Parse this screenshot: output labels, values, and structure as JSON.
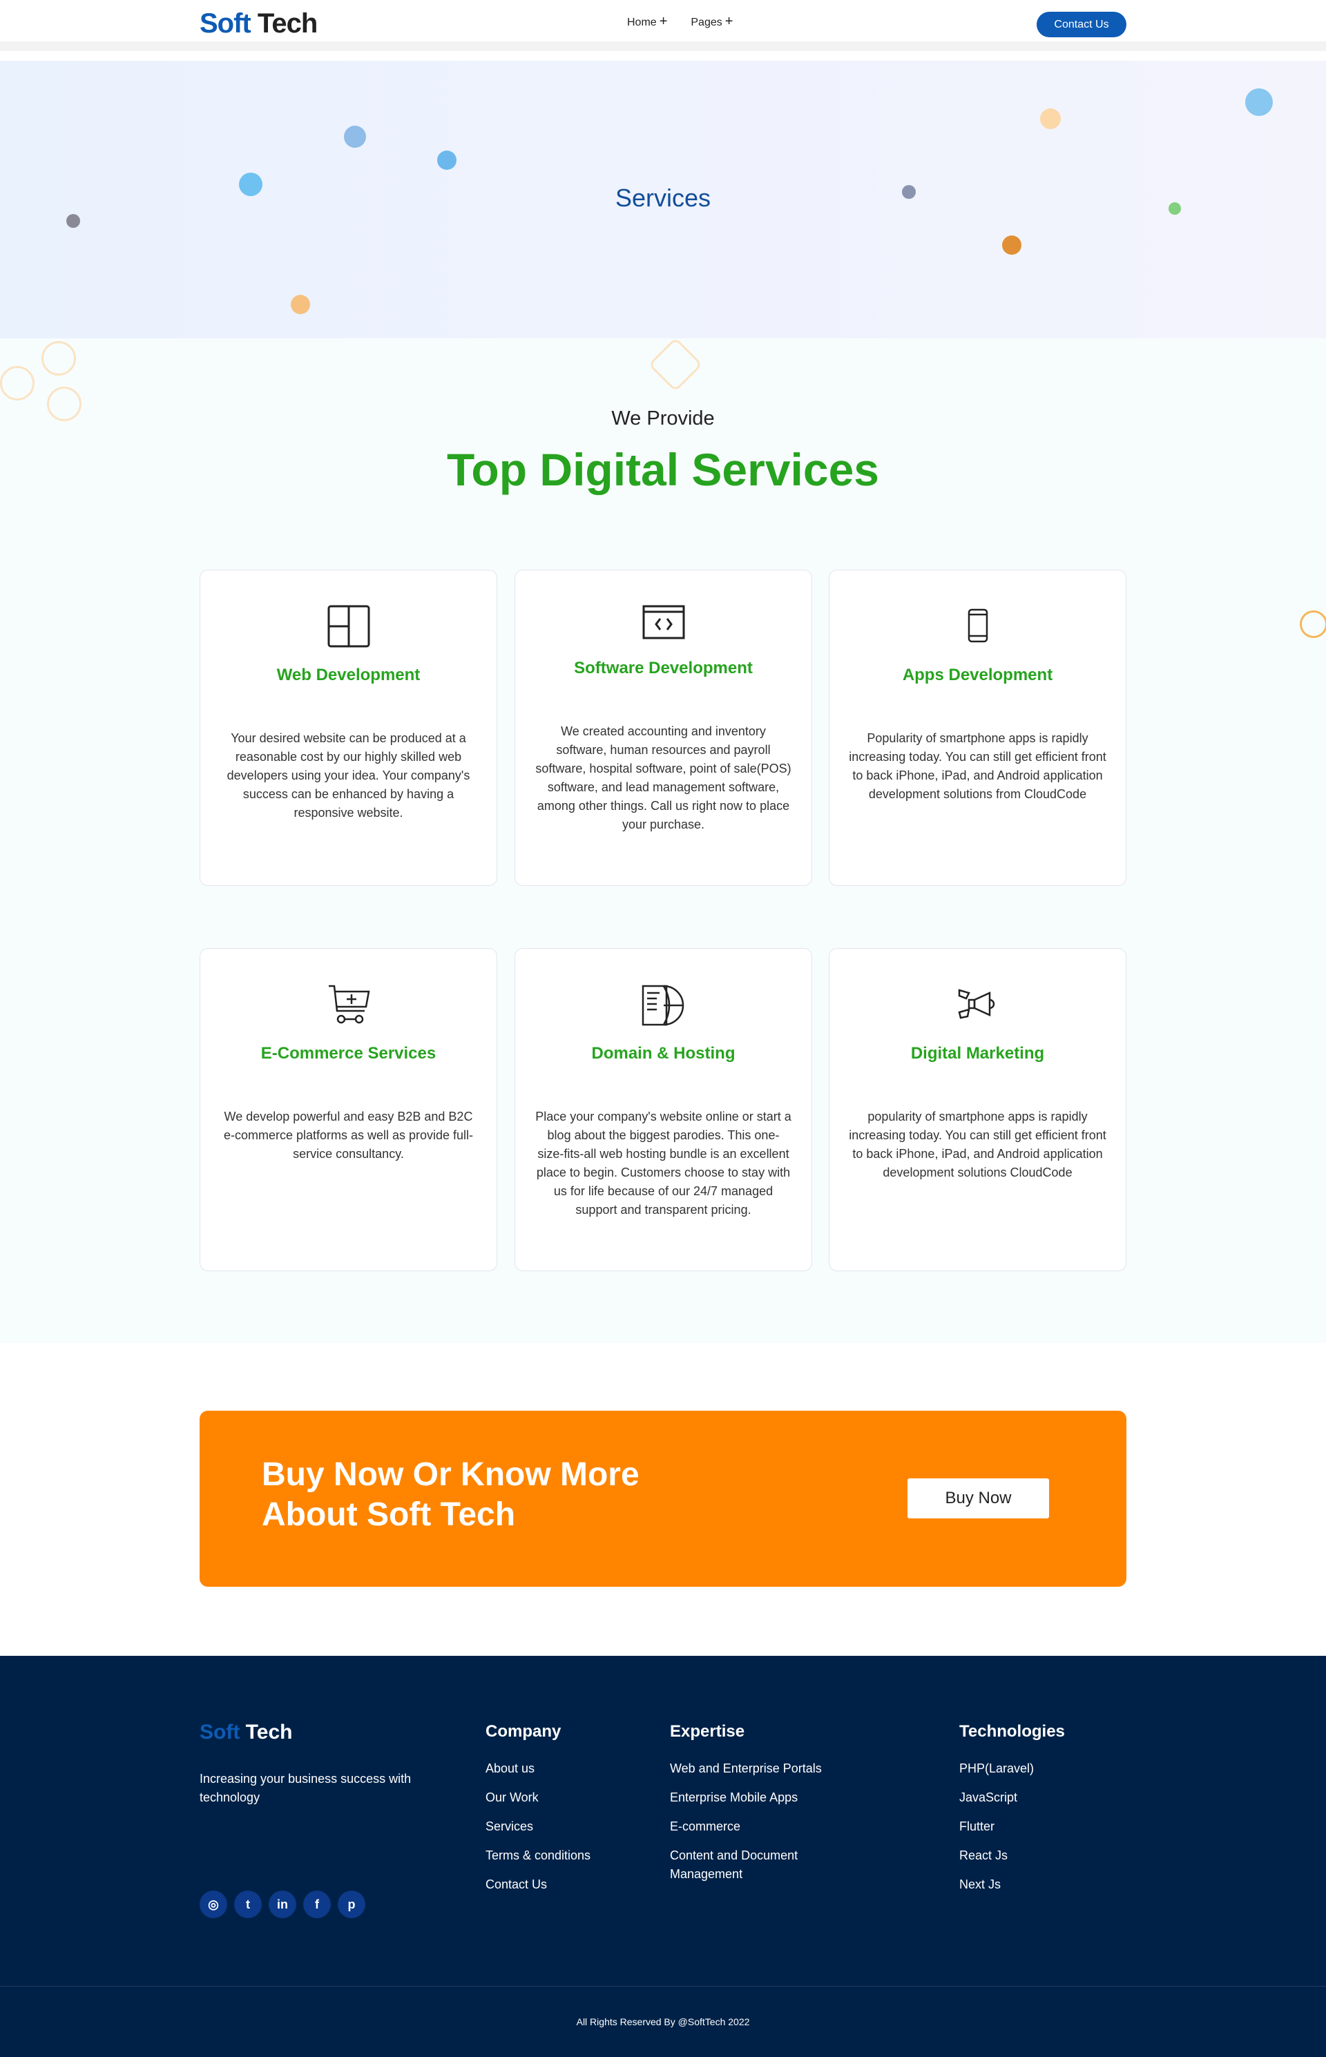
{
  "header": {
    "logo_a": "Soft",
    "logo_b": "Tech",
    "nav": [
      {
        "label": "Home"
      },
      {
        "label": "Pages"
      }
    ],
    "contact": "Contact Us"
  },
  "hero": {
    "title": "Services"
  },
  "services": {
    "eyebrow": "We Provide",
    "title": "Top Digital Services",
    "cards": [
      {
        "icon": "layout-icon",
        "title": "Web Development",
        "text": "Your desired website can be produced at a reasonable cost by our highly skilled web developers using your idea. Your company's success can be enhanced by having a responsive website."
      },
      {
        "icon": "code-window-icon",
        "title": "Software Development",
        "text": "We created accounting and inventory software, human resources and payroll software, hospital software, point of sale(POS) software, and lead management software, among other things. Call us right now to place your purchase."
      },
      {
        "icon": "smartphone-icon",
        "title": "Apps Development",
        "text": "Popularity of smartphone apps is rapidly increasing today. You can still get efficient front to back iPhone, iPad, and Android application development solutions from CloudCode"
      },
      {
        "icon": "cart-icon",
        "title": "E-Commerce Services",
        "text": "We develop powerful and easy B2B and B2C e-commerce platforms as well as provide full-service consultancy."
      },
      {
        "icon": "globe-document-icon",
        "title": "Domain & Hosting",
        "text": "Place your company's website online or start a blog about the biggest parodies. This one-size-fits-all web hosting bundle is an excellent place to begin. Customers choose to stay with us for life because of our 24/7 managed support and transparent pricing."
      },
      {
        "icon": "megaphone-icon",
        "title": "Digital Marketing",
        "text": "popularity of smartphone apps is rapidly increasing today. You can still get efficient front to back iPhone, iPad, and Android application development solutions CloudCode"
      }
    ]
  },
  "cta": {
    "title": "Buy Now Or Know More About Soft Tech",
    "button": "Buy Now",
    "color": "#ff8500"
  },
  "footer": {
    "logo_a": "Soft",
    "logo_b": "Tech",
    "tagline": "Increasing your business success with technology",
    "social": [
      "instagram",
      "twitter",
      "linkedin",
      "facebook",
      "pinterest"
    ],
    "columns": [
      {
        "title": "Company",
        "links": [
          "About us",
          "Our Work",
          "Services",
          "Terms & conditions",
          "Contact Us"
        ]
      },
      {
        "title": "Expertise",
        "links": [
          "Web and Enterprise Portals",
          "Enterprise Mobile Apps",
          "E-commerce",
          "Content and Document Management"
        ]
      },
      {
        "title": "Technologies",
        "links": [
          "PHP(Laravel)",
          "JavaScript",
          "Flutter",
          "React Js",
          "Next Js"
        ]
      }
    ],
    "copyright": "All Rights Reserved By @SoftTech 2022"
  },
  "colors": {
    "brand": "#0d5bb5",
    "green": "#27a31f",
    "footer": "#002147"
  }
}
